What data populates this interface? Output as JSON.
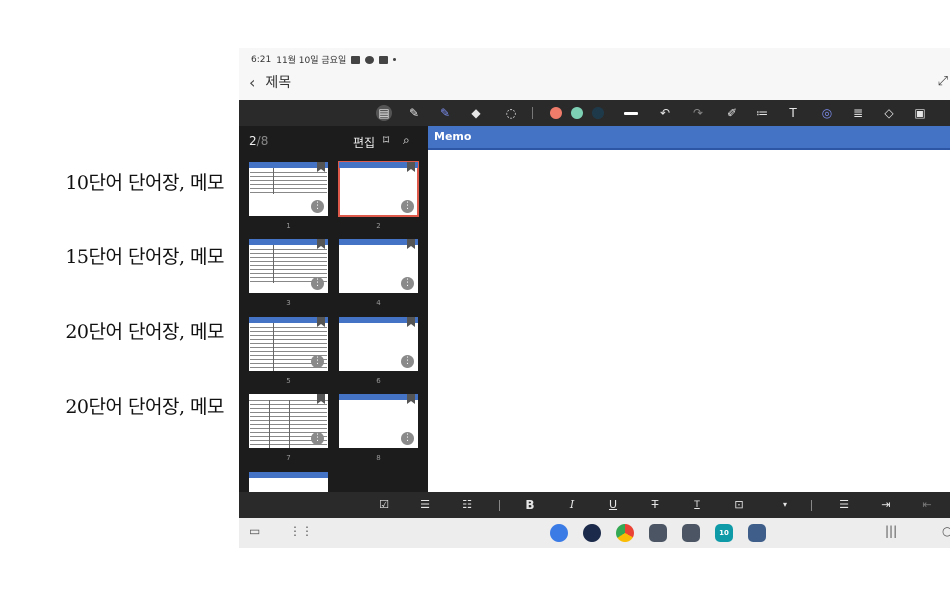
{
  "annotations": [
    "10단어 단어장, 메모",
    "15단어 단어장, 메모",
    "20단어 단어장, 메모",
    "20단어 단어장, 메모"
  ],
  "status_bar": {
    "time": "6:21",
    "date": "11월 10일 금요일"
  },
  "title_bar": {
    "back_icon": "‹",
    "title": "제목",
    "expand_icon": "⤢"
  },
  "pen_colors": [
    "#ef7b6b",
    "#7ed0b4",
    "#1e3a4a"
  ],
  "pages_panel": {
    "current": "2",
    "total": "8",
    "edit_label": "편집",
    "pages": [
      {
        "number": "1",
        "selected": false
      },
      {
        "number": "2",
        "selected": true
      },
      {
        "number": "3",
        "selected": false
      },
      {
        "number": "4",
        "selected": false
      },
      {
        "number": "5",
        "selected": false
      },
      {
        "number": "6",
        "selected": false
      },
      {
        "number": "7",
        "selected": false
      },
      {
        "number": "8",
        "selected": false
      }
    ]
  },
  "memo": {
    "title": "Memo"
  },
  "format_toolbar": {
    "bold": "B",
    "italic": "I",
    "underline": "U",
    "strike": "T",
    "text_size": "T",
    "caret": "▾"
  },
  "taskbar": {
    "calendar_day": "10"
  },
  "colors": {
    "accent": "#4472c4",
    "selected_outline": "#e05a4b",
    "toolbar_bg": "#2a2a2a"
  }
}
